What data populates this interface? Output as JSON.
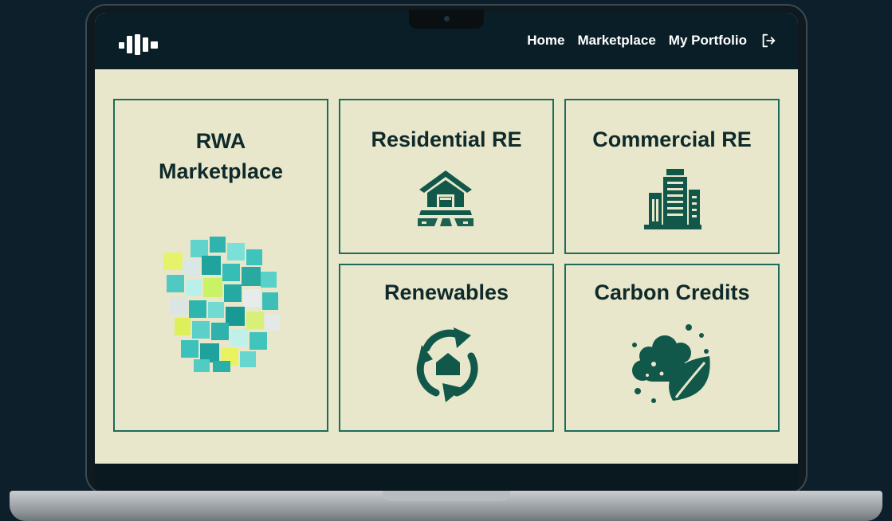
{
  "nav": {
    "links": [
      "Home",
      "Marketplace",
      "My Portfolio"
    ]
  },
  "cards": {
    "rwa": {
      "title_line1": "RWA",
      "title_line2": "Marketplace"
    },
    "residential": {
      "title": "Residential RE"
    },
    "commercial": {
      "title": "Commercial RE"
    },
    "renewables": {
      "title": "Renewables"
    },
    "carbon": {
      "title": "Carbon Credits"
    }
  },
  "colors": {
    "screen_bg": "#e8e7cb",
    "navbar_bg": "#0a1e28",
    "accent": "#1d6b5a",
    "icon": "#11584a"
  },
  "icons": [
    "logo-bars-icon",
    "logout-icon",
    "house-icon",
    "buildings-icon",
    "recycle-house-icon",
    "cloud-leaf-icon",
    "cube-cluster-image"
  ]
}
